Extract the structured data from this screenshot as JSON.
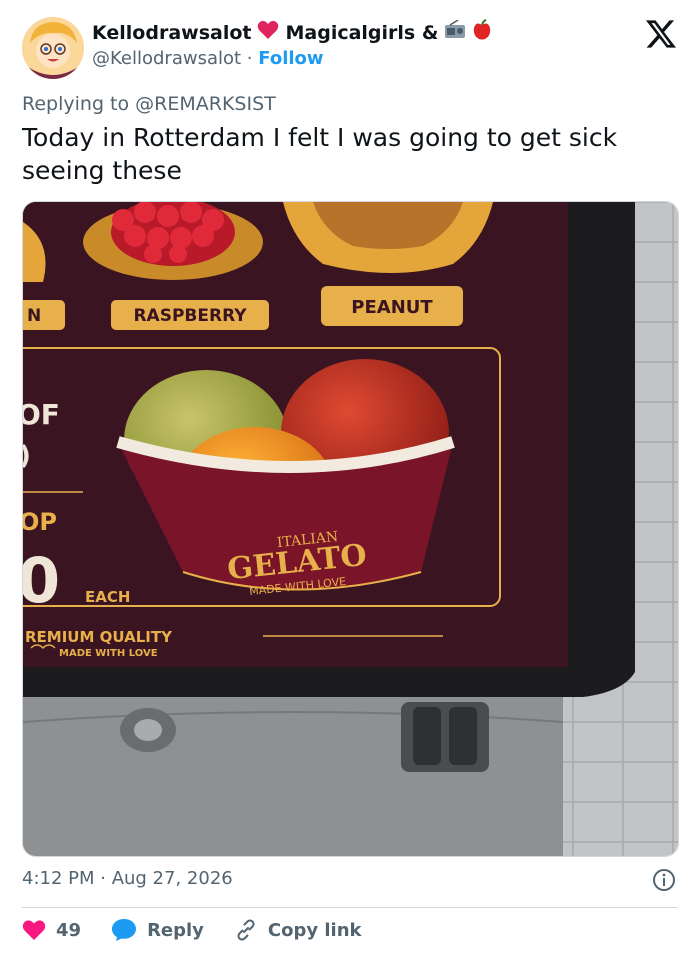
{
  "author": {
    "name": "Kellodrawsalot",
    "name_suffix": "Magicalgirls &",
    "handle": "@Kellodrawsalot",
    "separator": "·",
    "follow_label": "Follow"
  },
  "reply_to_text": "Replying to @REMARKSIST",
  "tweet_text": "Today in Rotterdam I felt I was going to get sick seeing these",
  "photo": {
    "labels": {
      "left_partial": "N",
      "raspberry": "RASPBERRY",
      "peanut": "PEANUT",
      "of_partial": "OF",
      "paren_partial": ")",
      "top_partial": "OP",
      "zero_partial": "0",
      "each": "EACH",
      "premium": "REMIUM QUALITY",
      "made_with_love_small": "MADE WITH LOVE",
      "cup_italian": "ITALIAN",
      "cup_gelato": "GELATO",
      "cup_made": "MADE WITH LOVE"
    }
  },
  "timestamp": "4:12 PM · Aug 27, 2026",
  "actions": {
    "likes": "49",
    "reply_label": "Reply",
    "copy_label": "Copy link"
  },
  "colors": {
    "like": "#f91880",
    "reply": "#1d9bf0",
    "board": "#3a1420",
    "gold": "#e8b04a"
  }
}
